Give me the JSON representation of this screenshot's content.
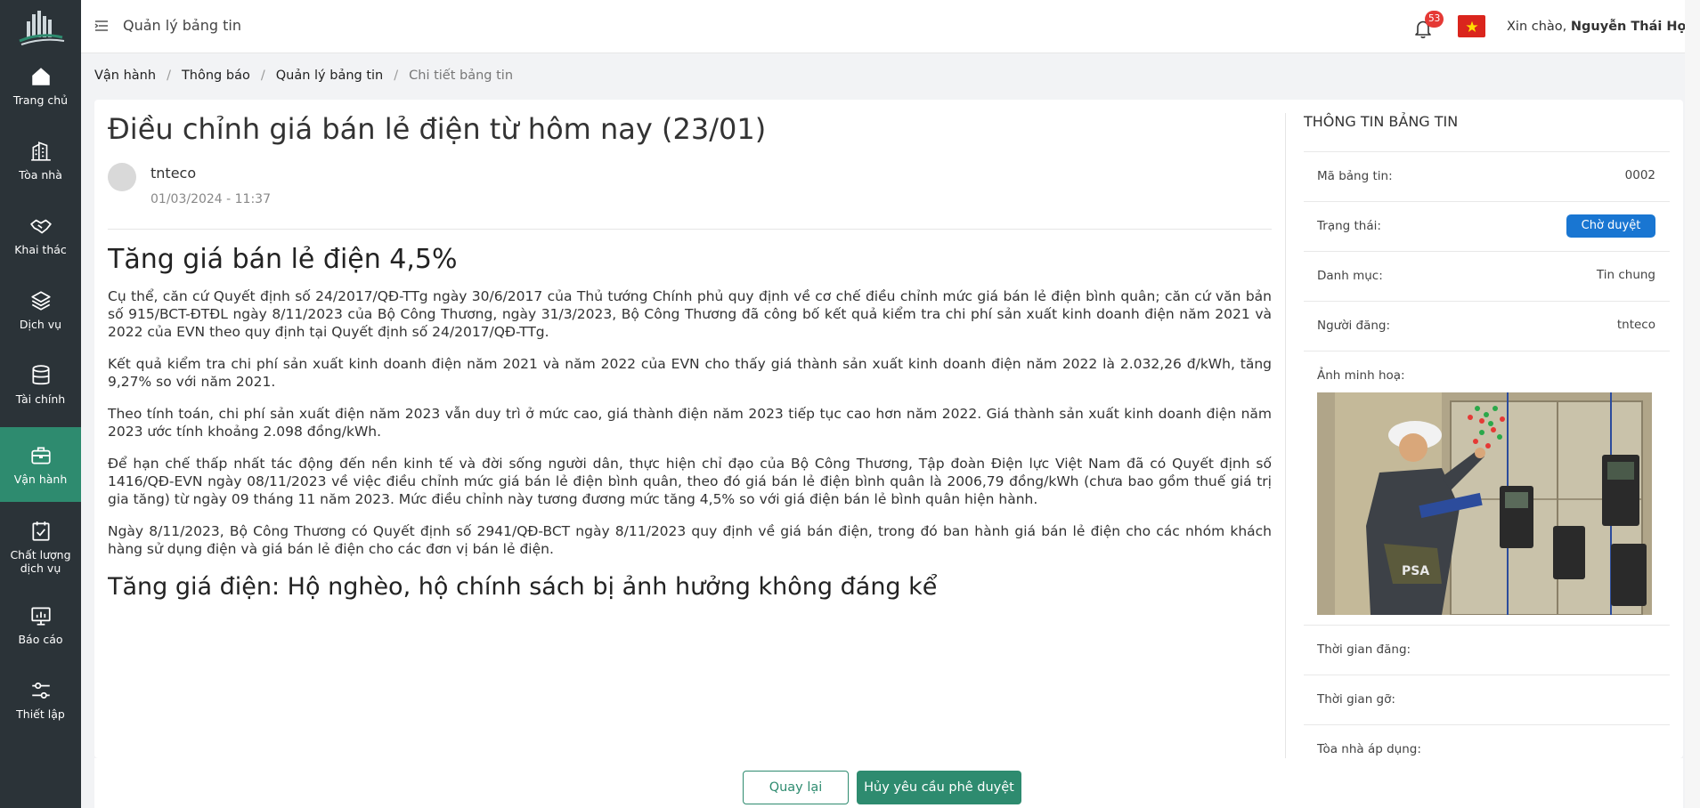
{
  "sidebar": {
    "logo_icon": "buildings-logo-icon",
    "items": [
      {
        "label": "Trang chủ",
        "icon": "home-icon"
      },
      {
        "label": "Tòa nhà",
        "icon": "building-icon"
      },
      {
        "label": "Khai thác",
        "icon": "handshake-icon"
      },
      {
        "label": "Dịch vụ",
        "icon": "layers-icon"
      },
      {
        "label": "Tài chính",
        "icon": "database-icon"
      },
      {
        "label": "Vận hành",
        "icon": "briefcase-icon",
        "active": true
      },
      {
        "label": "Chất lượng dịch vụ",
        "icon": "checklist-icon"
      },
      {
        "label": "Báo cáo",
        "icon": "presentation-icon"
      },
      {
        "label": "Thiết lập",
        "icon": "sliders-icon"
      }
    ],
    "active_color": "#2e8b6f",
    "bg_color": "#2b3338"
  },
  "header": {
    "title": "Quản lý bảng tin",
    "notification_count": "53",
    "greeting_prefix": "Xin chào, ",
    "user_name": "Nguyễn Thái Học"
  },
  "breadcrumb": [
    "Vận hành",
    "Thông báo",
    "Quản lý bảng tin",
    "Chi tiết bảng tin"
  ],
  "article": {
    "title": "Điều chỉnh giá bán lẻ điện từ hôm nay (23/01)",
    "author": "tnteco",
    "date": "01/03/2024 - 11:37",
    "heading": "Tăng giá bán lẻ điện 4,5%",
    "paragraphs": [
      "Cụ thể, căn cứ Quyết định số 24/2017/QĐ-TTg ngày 30/6/2017 của Thủ tướng Chính phủ quy định về cơ chế điều chỉnh mức giá bán lẻ điện bình quân; căn cứ văn bản số 915/BCT-ĐTĐL ngày 8/11/2023 của Bộ Công Thương, ngày 31/3/2023, Bộ Công Thương đã công bố kết quả kiểm tra chi phí sản xuất kinh doanh điện năm 2021 và 2022 của EVN theo quy định tại Quyết định số 24/2017/QĐ-TTg.",
      "Kết quả kiểm tra chi phí sản xuất kinh doanh điện năm 2021 và năm 2022 của EVN cho thấy giá thành sản xuất kinh doanh điện năm 2022 là 2.032,26 đ/kWh, tăng 9,27% so với năm 2021.",
      "Theo tính toán, chi phí sản xuất điện năm 2023 vẫn duy trì ở mức cao, giá thành điện năm 2023 tiếp tục cao hơn năm 2022. Giá thành sản xuất kinh doanh điện năm 2023 ước tính khoảng 2.098 đồng/kWh.",
      "Để hạn chế thấp nhất tác động đến nền kinh tế và đời sống người dân, thực hiện chỉ đạo của Bộ Công Thương, Tập đoàn Điện lực Việt Nam đã có Quyết định số 1416/QĐ-EVN ngày 08/11/2023 về việc điều chỉnh mức giá bán lẻ điện bình quân, theo đó giá bán lẻ điện bình quân là 2006,79 đồng/kWh (chưa bao gồm thuế giá trị gia tăng) từ ngày 09 tháng 11 năm 2023. Mức điều chỉnh này tương đương mức tăng 4,5% so với giá điện bán lẻ bình quân hiện hành.",
      "Ngày 8/11/2023, Bộ Công Thương có Quyết định số 2941/QĐ-BCT ngày 8/11/2023 quy định về giá bán điện, trong đó ban hành giá bán lẻ điện cho các nhóm khách hàng sử dụng điện và giá bán lẻ điện cho các đơn vị bán lẻ điện."
    ],
    "subheading": "Tăng giá điện: Hộ nghèo, hộ chính sách bị ảnh hưởng không đáng kể"
  },
  "panel": {
    "title": "THÔNG TIN BẢNG TIN",
    "code_label": "Mã bảng tin:",
    "code_value": "0002",
    "status_label": "Trạng thái:",
    "status_value": "Chờ duyệt",
    "status_color": "#1976d2",
    "category_label": "Danh mục:",
    "category_value": "Tin chung",
    "poster_label": "Người đăng:",
    "poster_value": "tnteco",
    "image_label": "Ảnh minh hoạ:",
    "image_caption_text": "PSA",
    "post_time_label": "Thời gian đăng:",
    "remove_time_label": "Thời gian gỡ:",
    "building_label": "Tòa nhà áp dụng:"
  },
  "footer": {
    "back_label": "Quay lại",
    "cancel_label": "Hủy yêu cầu phê duyệt"
  }
}
